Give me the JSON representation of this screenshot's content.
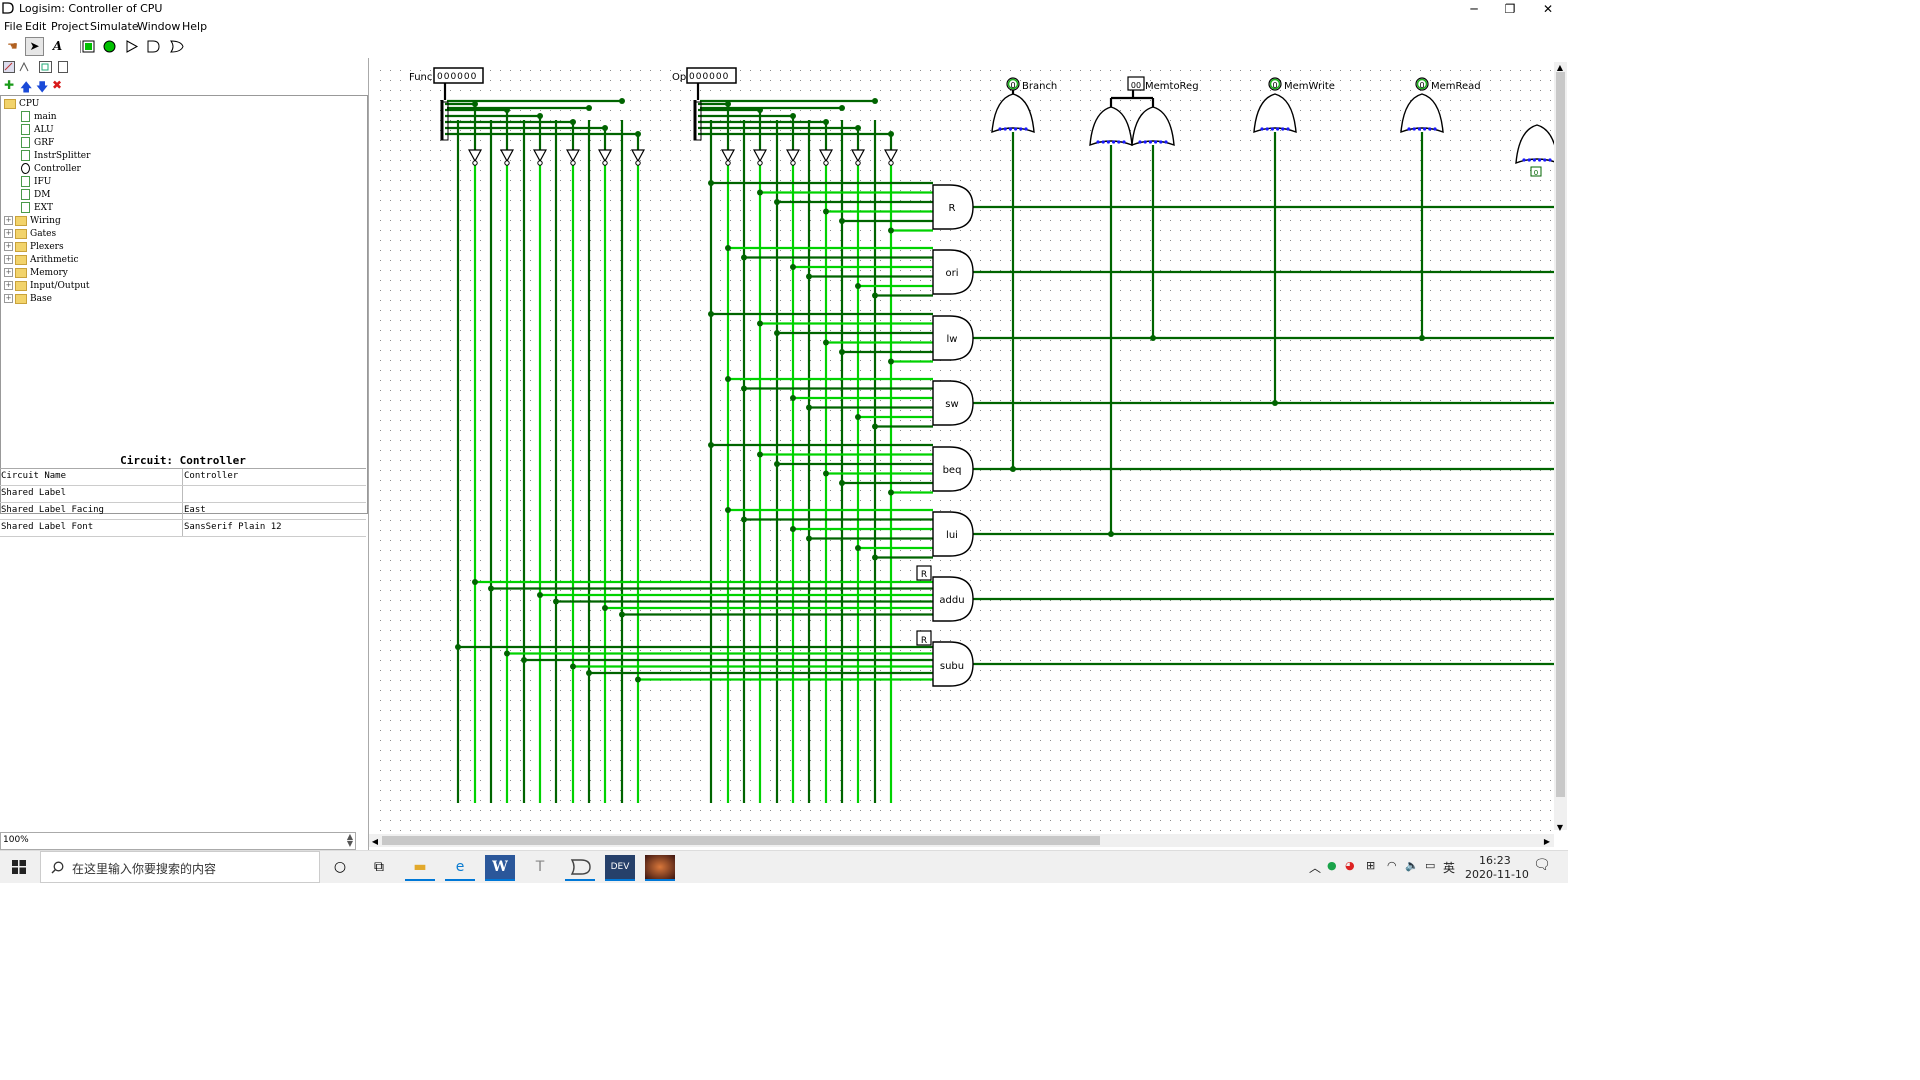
{
  "window": {
    "title": "Logisim: Controller of CPU",
    "minimize": "─",
    "restore": "❐",
    "close": "✕"
  },
  "menu": [
    "File",
    "Edit",
    "Project",
    "Simulate",
    "Window",
    "Help"
  ],
  "tree": {
    "root": "CPU",
    "circuits": [
      "main",
      "ALU",
      "GRF",
      "InstrSplitter",
      "Controller",
      "IFU",
      "DM",
      "EXT"
    ],
    "libraries": [
      "Wiring",
      "Gates",
      "Plexers",
      "Arithmetic",
      "Memory",
      "Input/Output",
      "Base"
    ]
  },
  "attributes": {
    "header": "Circuit: Controller",
    "rows": [
      {
        "key": "Circuit Name",
        "value": "Controller"
      },
      {
        "key": "Shared Label",
        "value": ""
      },
      {
        "key": "Shared Label Facing",
        "value": "East"
      },
      {
        "key": "Shared Label Font",
        "value": "SansSerif Plain 12"
      }
    ]
  },
  "zoom": "100%",
  "circuit": {
    "func_label": "Func",
    "func_value": "000000",
    "op_label": "Op",
    "op_value": "000000",
    "gates": [
      "R",
      "ori",
      "lw",
      "sw",
      "beq",
      "lui",
      "addu",
      "subu"
    ],
    "tunnel_label": "R",
    "outputs": [
      {
        "label": "Branch",
        "value": "0"
      },
      {
        "label": "MemtoReg",
        "value": "00"
      },
      {
        "label": "MemWrite",
        "value": "0"
      },
      {
        "label": "MemRead",
        "value": "0"
      }
    ],
    "probe_zero": "0",
    "colors": {
      "wire_dark": "#006400",
      "wire_light": "#00d200",
      "bubble": "#1818ff"
    }
  },
  "taskbar": {
    "search_placeholder": "在这里输入你要搜索的内容",
    "time": "16:23",
    "date": "2020-11-10",
    "ime": "英"
  }
}
